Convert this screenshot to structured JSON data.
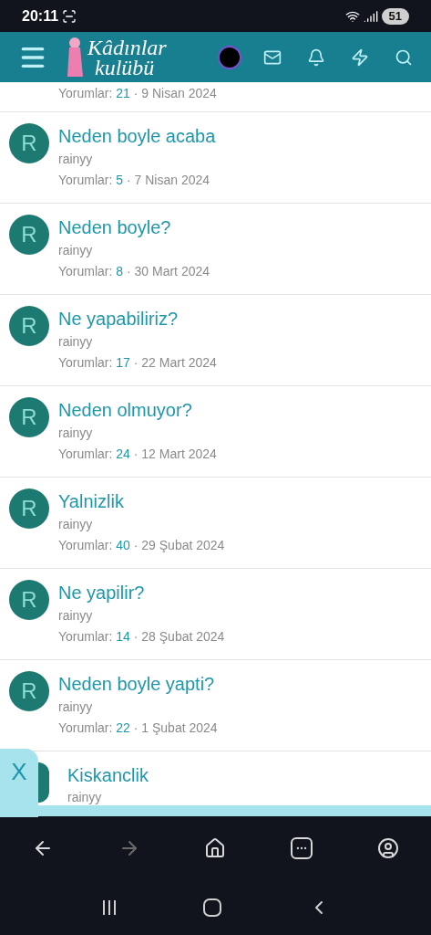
{
  "status_bar": {
    "time": "20:11",
    "battery": "51"
  },
  "header": {
    "logo_line_1": "Kâdınlar",
    "logo_line_2": "kulübü"
  },
  "threads": [
    {
      "kind": "partial_top",
      "comments_label": "Yorumlar:",
      "comments": "21",
      "date": "· 9 Nisan 2024"
    },
    {
      "kind": "full",
      "avatar": "R",
      "title": "Neden boyle acaba",
      "author": "rainyy",
      "comments_label": "Yorumlar:",
      "comments": "5",
      "date": "· 7 Nisan 2024"
    },
    {
      "kind": "full",
      "avatar": "R",
      "title": "Neden boyle?",
      "author": "rainyy",
      "comments_label": "Yorumlar:",
      "comments": "8",
      "date": "· 30 Mart 2024"
    },
    {
      "kind": "full",
      "avatar": "R",
      "title": "Ne yapabiliriz?",
      "author": "rainyy",
      "comments_label": "Yorumlar:",
      "comments": "17",
      "date": "· 22 Mart 2024"
    },
    {
      "kind": "full",
      "avatar": "R",
      "title": "Neden olmuyor?",
      "author": "rainyy",
      "comments_label": "Yorumlar:",
      "comments": "24",
      "date": "· 12 Mart 2024"
    },
    {
      "kind": "full",
      "avatar": "R",
      "title": "Yalnizlik",
      "author": "rainyy",
      "comments_label": "Yorumlar:",
      "comments": "40",
      "date": "· 29 Şubat 2024"
    },
    {
      "kind": "full",
      "avatar": "R",
      "title": "Ne yapilir?",
      "author": "rainyy",
      "comments_label": "Yorumlar:",
      "comments": "14",
      "date": "· 28 Şubat 2024"
    },
    {
      "kind": "full",
      "avatar": "R",
      "title": "Neden boyle yapti?",
      "author": "rainyy",
      "comments_label": "Yorumlar:",
      "comments": "22",
      "date": "· 1 Şubat 2024"
    },
    {
      "kind": "partial_bottom",
      "title": "Kiskanclik",
      "author": "rainyy"
    }
  ],
  "close_tab": {
    "label": "X"
  },
  "browser_nav": {
    "forward_disabled": true
  }
}
